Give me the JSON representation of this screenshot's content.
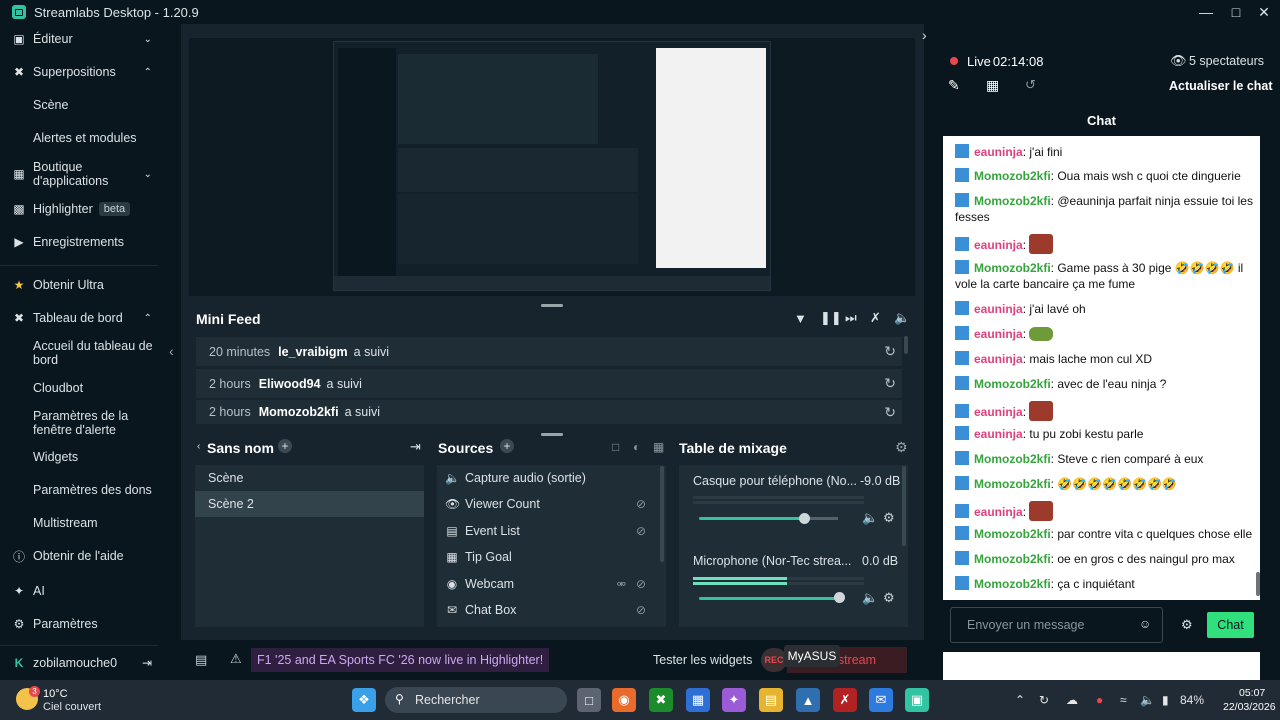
{
  "window": {
    "title": "Streamlabs Desktop - 1.20.9"
  },
  "sidebar": {
    "items": [
      {
        "label": "Éditeur"
      },
      {
        "label": "Superpositions"
      },
      {
        "label": "Scène"
      },
      {
        "label": "Alertes et modules"
      },
      {
        "label": "Boutique d'applications"
      },
      {
        "label": "Highlighter",
        "badge": "beta"
      },
      {
        "label": "Enregistrements"
      },
      {
        "label": "Obtenir Ultra"
      },
      {
        "label": "Tableau de bord"
      },
      {
        "label": "Accueil du tableau de bord"
      },
      {
        "label": "Cloudbot"
      },
      {
        "label": "Paramètres de la fenêtre d'alerte"
      },
      {
        "label": "Widgets"
      },
      {
        "label": "Paramètres des dons"
      },
      {
        "label": "Multistream"
      },
      {
        "label": "Obtenir de l'aide"
      },
      {
        "label": "AI"
      },
      {
        "label": "Paramètres"
      }
    ],
    "user": "zobilamouche0"
  },
  "mini_feed": {
    "title": "Mini Feed",
    "rows": [
      {
        "time": "20 minutes",
        "name": "le_vraibigm",
        "action": "a suivi"
      },
      {
        "time": "2 hours",
        "name": "Eliwood94",
        "action": "a suivi"
      },
      {
        "time": "2 hours",
        "name": "Momozob2kfi",
        "action": "a suivi"
      }
    ]
  },
  "scenes": {
    "title": "Sans nom",
    "items": [
      "Scène",
      "Scène 2"
    ],
    "selected_index": 1
  },
  "sources": {
    "title": "Sources",
    "items": [
      {
        "label": "Capture audio (sortie)",
        "icon": "speaker-icon"
      },
      {
        "label": "Viewer Count",
        "icon": "eye-icon"
      },
      {
        "label": "Event List",
        "icon": "list-icon"
      },
      {
        "label": "Tip Goal",
        "icon": "calendar-icon"
      },
      {
        "label": "Webcam",
        "icon": "camera-icon"
      },
      {
        "label": "Chat Box",
        "icon": "chat-icon"
      }
    ]
  },
  "mixer": {
    "title": "Table de mixage",
    "channels": [
      {
        "name": "Casque pour téléphone (No...",
        "db": "-9.0 dB",
        "level": 0.73
      },
      {
        "name": "Microphone (Nor-Tec strea...",
        "db": "0.0 dB",
        "level": 1.0
      }
    ]
  },
  "footer": {
    "notification": "F1 '25 and EA Sports FC '26 now live in Highlighter!",
    "test_widgets": "Tester les widgets",
    "tooltip": "MyASUS",
    "end_stream": "r le stream"
  },
  "live": {
    "label": "Live",
    "timer": "02:14:08",
    "viewers": "5 spectateurs",
    "refresh_chat": "Actualiser le chat"
  },
  "chat": {
    "title": "Chat",
    "messages": [
      {
        "user": "eauninja",
        "color": "u1",
        "text": "j'ai fini"
      },
      {
        "user": "Momozob2kfi",
        "color": "u2",
        "text": "Oua mais wsh c quoi cte dinguerie"
      },
      {
        "user": "Momozob2kfi",
        "color": "u2",
        "text": "@eauninja parfait ninja essuie toi les fesses"
      },
      {
        "user": "eauninja",
        "color": "u1",
        "text": ""
      },
      {
        "user": "Momozob2kfi",
        "color": "u2",
        "text": "Game pass à 30 pige 🤣🤣🤣🤣 il vole la carte bancaire ça me fume"
      },
      {
        "user": "eauninja",
        "color": "u1",
        "text": "j'ai lavé oh"
      },
      {
        "user": "eauninja",
        "color": "u1",
        "text": ""
      },
      {
        "user": "eauninja",
        "color": "u1",
        "text": "mais lache mon cul XD"
      },
      {
        "user": "Momozob2kfi",
        "color": "u2",
        "text": "avec de l'eau ninja ?"
      },
      {
        "user": "eauninja",
        "color": "u1",
        "text": ""
      },
      {
        "user": "eauninja",
        "color": "u1",
        "text": "tu pu zobi kestu parle"
      },
      {
        "user": "Momozob2kfi",
        "color": "u2",
        "text": "Steve c rien comparé à eux"
      },
      {
        "user": "Momozob2kfi",
        "color": "u2",
        "text": "🤣🤣🤣🤣🤣🤣🤣🤣"
      },
      {
        "user": "eauninja",
        "color": "u1",
        "text": ""
      },
      {
        "user": "Momozob2kfi",
        "color": "u2",
        "text": "par contre vita c quelques chose elle"
      },
      {
        "user": "Momozob2kfi",
        "color": "u2",
        "text": "oe en gros c des naingul pro max"
      },
      {
        "user": "Momozob2kfi",
        "color": "u2",
        "text": "ça c inquiétant"
      }
    ],
    "input_placeholder": "Envoyer un message",
    "send_label": "Chat"
  },
  "taskbar": {
    "weather_temp": "10°C",
    "weather_desc": "Ciel couvert",
    "search_placeholder": "Rechercher",
    "battery": "84%",
    "time": "05:07",
    "date": "22/03/2026"
  },
  "colors": {
    "accent": "#31c3a2",
    "live": "#e5484d",
    "bg": "#09161d",
    "panel": "#17242d"
  }
}
